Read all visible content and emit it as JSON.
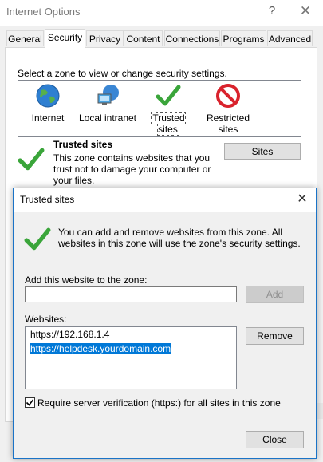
{
  "window": {
    "title": "Internet Options",
    "help_glyph": "?",
    "close_glyph": "✕"
  },
  "tabs": [
    {
      "label": "General"
    },
    {
      "label": "Security",
      "active": true
    },
    {
      "label": "Privacy"
    },
    {
      "label": "Content"
    },
    {
      "label": "Connections"
    },
    {
      "label": "Programs"
    },
    {
      "label": "Advanced"
    }
  ],
  "security": {
    "select_zone_label": "Select a zone to view or change security settings.",
    "zones": [
      {
        "label": "Internet",
        "icon": "globe-icon"
      },
      {
        "label": "Local intranet",
        "icon": "network-computer-icon"
      },
      {
        "label": "Trusted sites",
        "icon": "green-check-icon",
        "selected": true
      },
      {
        "label": "Restricted sites",
        "label_line1": "Restricted",
        "label_line2": "sites",
        "icon": "red-prohibited-icon"
      }
    ],
    "zone_title": "Trusted sites",
    "zone_desc": "This zone contains websites that you trust not to damage your computer or your files.",
    "sites_button": "Sites"
  },
  "dialog": {
    "title": "Trusted sites",
    "close_glyph": "✕",
    "description": "You can add and remove websites from this zone. All websites in this zone will use the zone's security settings.",
    "add_label": "Add this website to the zone:",
    "add_value": "",
    "add_button": "Add",
    "websites_label": "Websites:",
    "websites": [
      {
        "url": "https://192.168.1.4",
        "selected": false
      },
      {
        "url": "https://helpdesk.yourdomain.com",
        "selected": true
      }
    ],
    "remove_button": "Remove",
    "verify_checked": true,
    "verify_label": "Require server verification (https:) for all sites in this zone",
    "close_button": "Close"
  },
  "colors": {
    "selection": "#0078d7",
    "dialog_border": "#1a73c7",
    "check_green": "#3aa53a",
    "prohibited_red": "#d9232d"
  }
}
